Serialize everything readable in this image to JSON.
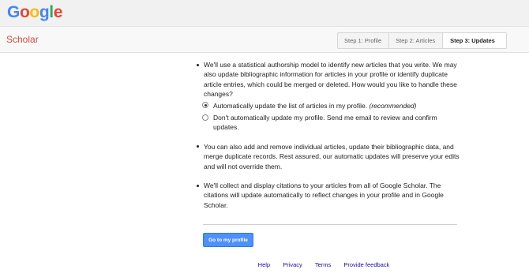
{
  "header": {
    "logo_letters": [
      {
        "ch": "G",
        "color": "#4285f4"
      },
      {
        "ch": "o",
        "color": "#ea4335"
      },
      {
        "ch": "o",
        "color": "#fbbc05"
      },
      {
        "ch": "g",
        "color": "#4285f4"
      },
      {
        "ch": "l",
        "color": "#34a853"
      },
      {
        "ch": "e",
        "color": "#ea4335"
      }
    ],
    "product_name": "Scholar"
  },
  "steps": [
    {
      "label": "Step 1: Profile",
      "active": false
    },
    {
      "label": "Step 2: Articles",
      "active": false
    },
    {
      "label": "Step 3: Updates",
      "active": true
    }
  ],
  "content": {
    "bullet1": "We'll use a statistical authorship model to identify new articles that you write. We may also update bibliographic information for articles in your profile or identify duplicate article entries, which could be merged or deleted. How would you like to handle these changes?",
    "option_auto_label": "Automatically update the list of articles in my profile.",
    "option_auto_note": "(recommended)",
    "option_auto_checked": true,
    "option_manual_label": "Don't automatically update my profile. Send me email to review and confirm updates.",
    "option_manual_checked": false,
    "bullet2": "You can also add and remove individual articles, update their bibliographic data, and merge duplicate records. Rest assured, our automatic updates will preserve your edits and will not override them.",
    "bullet3": "We'll collect and display citations to your articles from all of Google Scholar. The citations will update automatically to reflect changes in your profile and in Google Scholar."
  },
  "actions": {
    "primary_label": "Go to my profile",
    "primary_color": "#4d90fe"
  },
  "footer": {
    "links": [
      "Help",
      "Privacy",
      "Terms",
      "Provide feedback"
    ]
  }
}
